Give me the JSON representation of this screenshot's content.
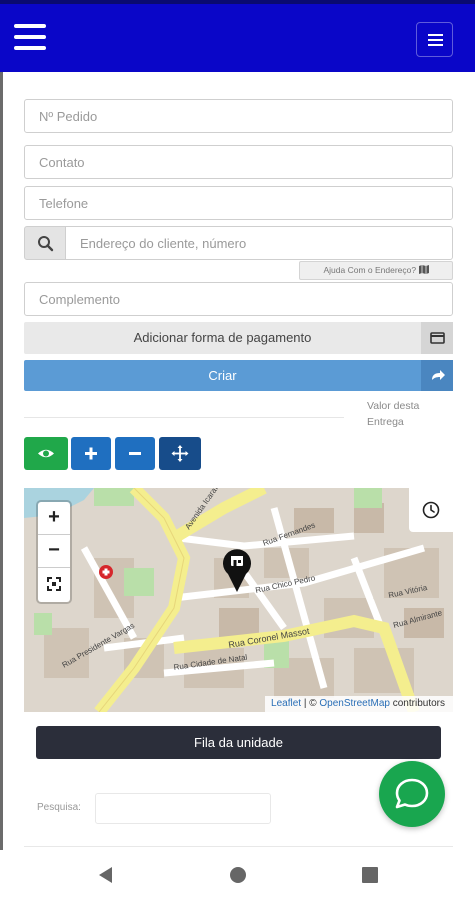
{
  "form": {
    "pedido_placeholder": "Nº Pedido",
    "contato_placeholder": "Contato",
    "telefone_placeholder": "Telefone",
    "endereco_placeholder": "Endereço do cliente, número",
    "ajuda_endereco": "Ajuda Com o Endereço?",
    "complemento_placeholder": "Complemento",
    "pagamento_label": "Adicionar forma de pagamento",
    "criar_label": "Criar",
    "valor_label": "Valor desta Entrega"
  },
  "map": {
    "zoom_in": "+",
    "zoom_out": "−",
    "street_labels": [
      "Avenida Icaraí",
      "Rua Fernandes",
      "Rua Chico Pedro",
      "Rua Coronel Massot",
      "Rua Cidade de Natal",
      "Rua Vitória",
      "Rua Presidente Vargas",
      "Rua Almirante"
    ],
    "attribution_leaflet": "Leaflet",
    "attribution_sep": " | © ",
    "attribution_osm": "OpenStreetMap",
    "attribution_contrib": " contributors"
  },
  "fila": {
    "label": "Fila da unidade"
  },
  "search": {
    "label": "Pesquisa:",
    "value": ""
  },
  "colors": {
    "header": "#0a06c8",
    "criar": "#5b9bd5",
    "eye": "#20a84a",
    "plus_minus": "#1f6fc0",
    "move": "#174c8a",
    "fila": "#2b2e3a",
    "chat": "#19a64f"
  },
  "icons": {
    "header_menu": "hamburger-icon",
    "header_toggle": "navbar-toggle-icon",
    "address": "search-icon",
    "help": "map-icon",
    "payment": "credit-card-icon",
    "criar": "share-arrow-icon",
    "eye": "eye-icon",
    "plus": "plus-icon",
    "minus": "minus-icon",
    "move": "move-arrows-icon",
    "fullscreen": "fullscreen-icon",
    "clock": "clock-icon",
    "store_marker": "store-marker-icon",
    "hospital": "hospital-icon",
    "chat": "chat-bubble-icon",
    "nav_back": "back-triangle-icon",
    "nav_home": "home-circle-icon",
    "nav_recents": "recents-square-icon"
  }
}
